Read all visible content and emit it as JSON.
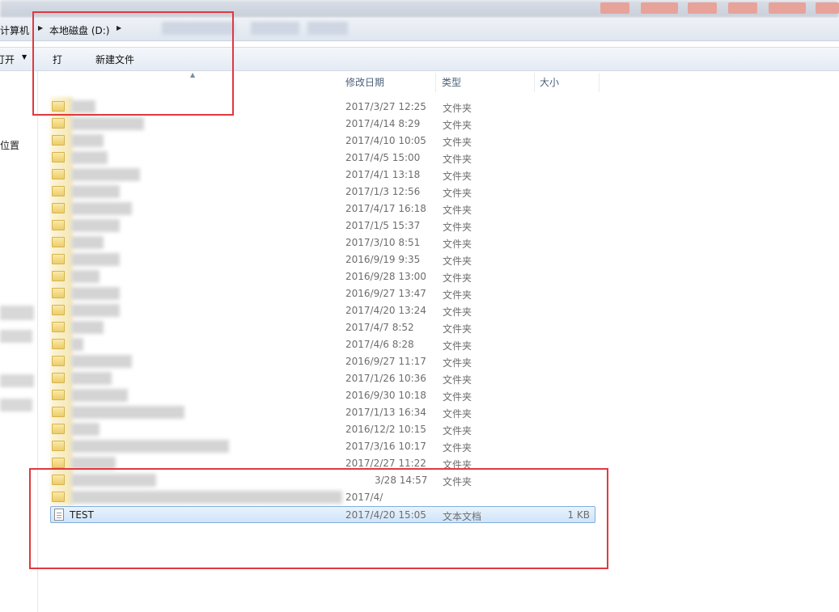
{
  "breadcrumb": {
    "computer": "计算机",
    "drive": "本地磁盘 (D:)"
  },
  "toolbar": {
    "open_label": "打开",
    "print_label": "打",
    "new_folder_label": "新建文件"
  },
  "nav": {
    "location_label": "位置"
  },
  "columns": {
    "modified": "修改日期",
    "type": "类型",
    "size": "大小"
  },
  "files": [
    {
      "date": "2017/3/27 12:25",
      "type": "文件夹"
    },
    {
      "date": "2017/4/14 8:29",
      "type": "文件夹"
    },
    {
      "date": "2017/4/10 10:05",
      "type": "文件夹"
    },
    {
      "date": "2017/4/5 15:00",
      "type": "文件夹"
    },
    {
      "date": "2017/4/1 13:18",
      "type": "文件夹"
    },
    {
      "date": "2017/1/3 12:56",
      "type": "文件夹"
    },
    {
      "date": "2017/4/17 16:18",
      "type": "文件夹"
    },
    {
      "date": "2017/1/5 15:37",
      "type": "文件夹"
    },
    {
      "date": "2017/3/10 8:51",
      "type": "文件夹"
    },
    {
      "date": "2016/9/19 9:35",
      "type": "文件夹"
    },
    {
      "date": "2016/9/28 13:00",
      "type": "文件夹"
    },
    {
      "date": "2016/9/27 13:47",
      "type": "文件夹"
    },
    {
      "date": "2017/4/20 13:24",
      "type": "文件夹"
    },
    {
      "date": "2017/4/7 8:52",
      "type": "文件夹"
    },
    {
      "date": "2017/4/6 8:28",
      "type": "文件夹"
    },
    {
      "date": "2016/9/27 11:17",
      "type": "文件夹"
    },
    {
      "date": "2017/1/26 10:36",
      "type": "文件夹"
    },
    {
      "date": "2016/9/30 10:18",
      "type": "文件夹"
    },
    {
      "date": "2017/1/13 16:34",
      "type": "文件夹"
    },
    {
      "date": "2016/12/2 10:15",
      "type": "文件夹"
    },
    {
      "date": "2017/3/16 10:17",
      "type": "文件夹"
    },
    {
      "date": "2017/2/27 11:22",
      "type": "文件夹"
    },
    {
      "date": "3/28 14:57",
      "type": "文件夹"
    },
    {
      "date": "2017/4/",
      "type": ""
    }
  ],
  "selected_file": {
    "name": "TEST",
    "date": "2017/4/20 15:05",
    "type": "文本文档",
    "size": "1 KB"
  },
  "colors": {
    "highlight_border": "#e0393f",
    "selection_border": "#84acdd"
  }
}
